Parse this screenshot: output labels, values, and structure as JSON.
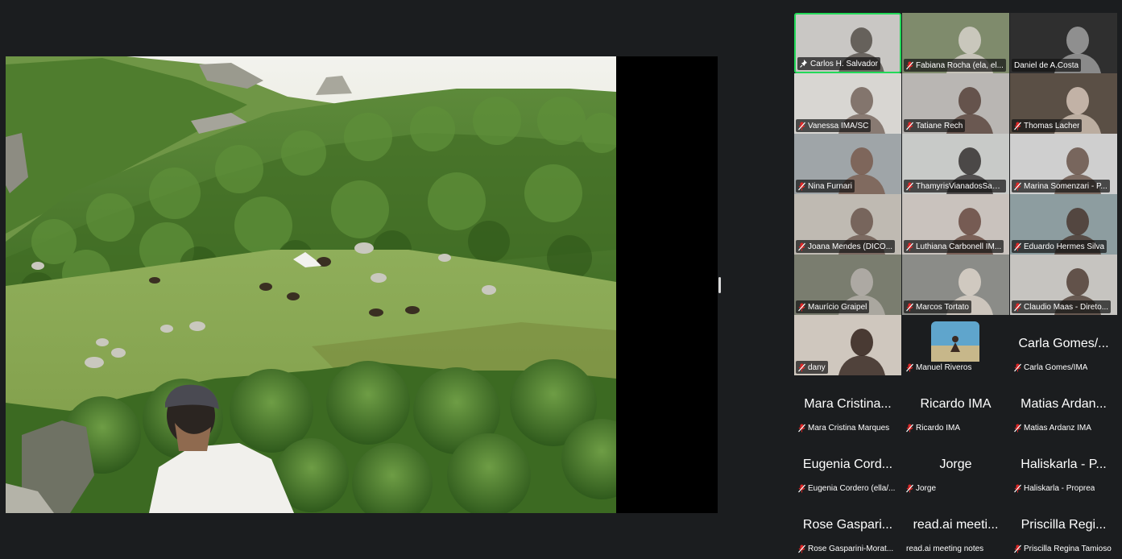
{
  "meeting": {
    "shared_content": "scenic-hillside-photo"
  },
  "participants": [
    {
      "label": "Carlos H. Salvador",
      "has_video": true,
      "active": true,
      "icon": "pin-icon"
    },
    {
      "label": "Fabiana Rocha (ela, el...",
      "has_video": true,
      "icon": "mic-muted-icon"
    },
    {
      "label": "Daniel de A.Costa",
      "has_video": true,
      "icon": "none"
    },
    {
      "label": "Vanessa IMA/SC",
      "has_video": true,
      "icon": "mic-muted-icon"
    },
    {
      "label": "Tatiane Rech",
      "has_video": true,
      "icon": "mic-muted-icon"
    },
    {
      "label": "Thomas Lacher",
      "has_video": true,
      "icon": "mic-muted-icon"
    },
    {
      "label": "Nina Furnari",
      "has_video": true,
      "icon": "mic-muted-icon"
    },
    {
      "label": "ThamyrisVianadosSant...",
      "has_video": true,
      "icon": "mic-muted-icon"
    },
    {
      "label": "Marina Somenzari - P...",
      "has_video": true,
      "icon": "mic-muted-icon"
    },
    {
      "label": "Joana Mendes (DICO...",
      "has_video": true,
      "icon": "mic-muted-icon"
    },
    {
      "label": "Luthiana Carbonell IM...",
      "has_video": true,
      "icon": "mic-muted-icon"
    },
    {
      "label": "Eduardo Hermes Silva",
      "has_video": true,
      "icon": "mic-muted-icon"
    },
    {
      "label": "Maurício Graipel",
      "has_video": true,
      "icon": "mic-muted-icon"
    },
    {
      "label": "Marcos Tortato",
      "has_video": true,
      "icon": "mic-muted-icon"
    },
    {
      "label": "Claudio Maas - Direto...",
      "has_video": true,
      "icon": "mic-muted-icon"
    },
    {
      "label": "dany",
      "has_video": true,
      "icon": "mic-muted-icon"
    },
    {
      "label": "Manuel Riveros",
      "has_video": false,
      "avatar": true,
      "icon": "mic-muted-icon"
    },
    {
      "label": "Carla Gomes/IMA",
      "big_name": "Carla Gomes/...",
      "has_video": false,
      "icon": "mic-muted-icon"
    },
    {
      "label": "Mara Cristina Marques",
      "big_name": "Mara Cristina...",
      "has_video": false,
      "icon": "mic-muted-icon"
    },
    {
      "label": "Ricardo IMA",
      "big_name": "Ricardo IMA",
      "has_video": false,
      "icon": "mic-muted-icon"
    },
    {
      "label": "Matias Ardanz IMA",
      "big_name": "Matias Ardan...",
      "has_video": false,
      "icon": "mic-muted-icon"
    },
    {
      "label": "Eugenia Cordero (ella/...",
      "big_name": "Eugenia Cord...",
      "has_video": false,
      "icon": "mic-muted-icon"
    },
    {
      "label": "Jorge",
      "big_name": "Jorge",
      "has_video": false,
      "icon": "mic-muted-icon"
    },
    {
      "label": "Haliskarla - Proprea",
      "big_name": "Haliskarla - P...",
      "has_video": false,
      "icon": "mic-muted-icon"
    },
    {
      "label": "Rose Gasparini-Morat...",
      "big_name": "Rose Gaspari...",
      "has_video": false,
      "icon": "mic-muted-icon"
    },
    {
      "label": "read.ai meeting notes",
      "big_name": "read.ai meeti...",
      "has_video": false,
      "icon": "none"
    },
    {
      "label": "Priscilla Regina Tamioso",
      "big_name": "Priscilla Regi...",
      "has_video": false,
      "icon": "mic-muted-icon"
    }
  ],
  "colors": {
    "background": "#1b1d1f",
    "active_border": "#23d959",
    "muted_red": "#e02828",
    "label_text": "#ffffff"
  }
}
